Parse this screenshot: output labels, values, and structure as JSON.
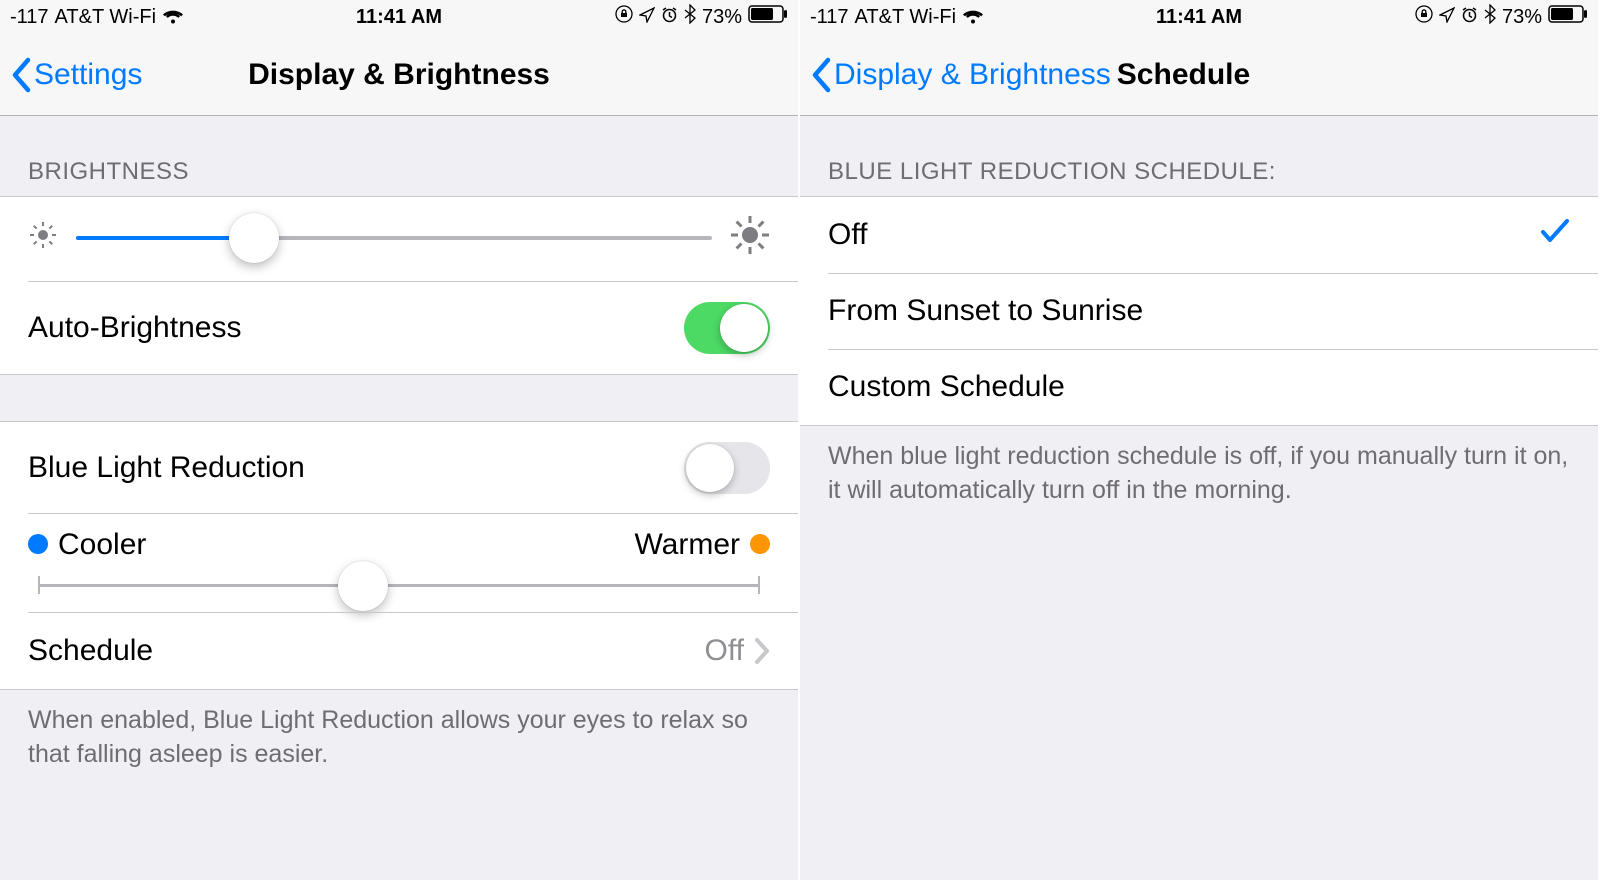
{
  "status": {
    "signal": "-117",
    "carrier": "AT&T Wi-Fi",
    "time": "11:41 AM",
    "battery_pct": "73%"
  },
  "left": {
    "back_label": "Settings",
    "title": "Display & Brightness",
    "brightness_header": "BRIGHTNESS",
    "brightness_pct": 28,
    "auto_brightness_label": "Auto-Brightness",
    "auto_brightness_on": true,
    "blr_label": "Blue Light Reduction",
    "blr_on": false,
    "cooler_label": "Cooler",
    "warmer_label": "Warmer",
    "temp_pct": 45,
    "schedule_label": "Schedule",
    "schedule_value": "Off",
    "footer": "When enabled, Blue Light Reduction allows your eyes to relax so that falling asleep is easier."
  },
  "right": {
    "back_label": "Display & Brightness",
    "title": "Schedule",
    "header": "BLUE LIGHT REDUCTION SCHEDULE:",
    "options": [
      {
        "label": "Off",
        "selected": true
      },
      {
        "label": "From Sunset to Sunrise",
        "selected": false
      },
      {
        "label": "Custom Schedule",
        "selected": false
      }
    ],
    "footer": "When blue light reduction schedule is off, if you manually turn it on, it will automatically turn off in the morning."
  }
}
